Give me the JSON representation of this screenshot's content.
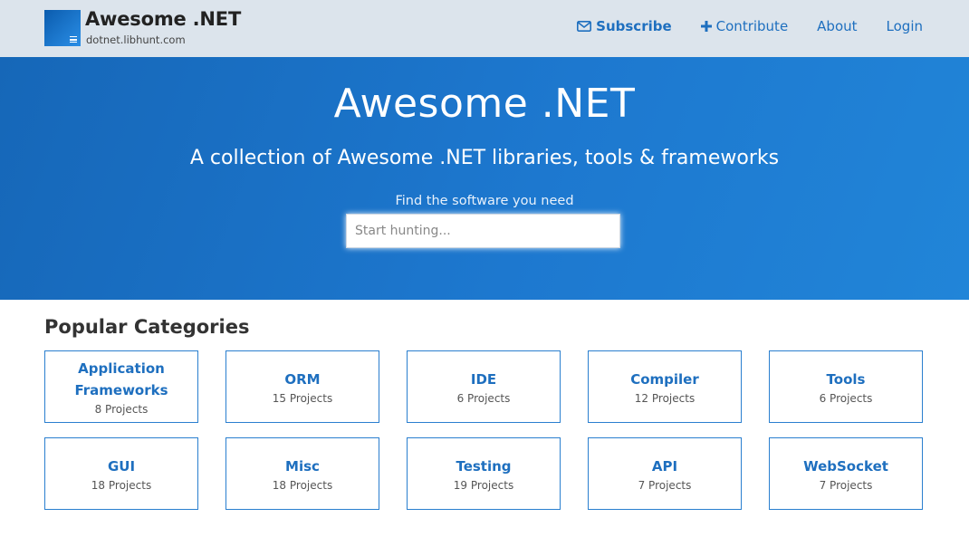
{
  "header": {
    "brand_title": "Awesome .NET",
    "brand_subtitle": "dotnet.libhunt.com",
    "logo_icon": "libhunt-logo-icon",
    "nav": [
      {
        "label": "Subscribe",
        "icon": "envelope-icon"
      },
      {
        "label": "Contribute",
        "icon": "plus-icon"
      },
      {
        "label": "About"
      },
      {
        "label": "Login"
      }
    ]
  },
  "hero": {
    "title": "Awesome .NET",
    "tagline": "A collection of Awesome .NET libraries, tools & frameworks",
    "prompt": "Find the software you need",
    "search_placeholder": "Start hunting..."
  },
  "categories": {
    "title": "Popular Categories",
    "items": [
      {
        "name": "Application Frameworks",
        "count": "8 Projects"
      },
      {
        "name": "ORM",
        "count": "15 Projects"
      },
      {
        "name": "IDE",
        "count": "6 Projects"
      },
      {
        "name": "Compiler",
        "count": "12 Projects"
      },
      {
        "name": "Tools",
        "count": "6 Projects"
      },
      {
        "name": "GUI",
        "count": "18 Projects"
      },
      {
        "name": "Misc",
        "count": "18 Projects"
      },
      {
        "name": "Testing",
        "count": "19 Projects"
      },
      {
        "name": "API",
        "count": "7 Projects"
      },
      {
        "name": "WebSocket",
        "count": "7 Projects"
      }
    ]
  },
  "colors": {
    "header_bg": "#dce4ec",
    "hero_bg": "#1d78cf",
    "link": "#1e6fbf",
    "card_border": "#2a7fcf"
  }
}
